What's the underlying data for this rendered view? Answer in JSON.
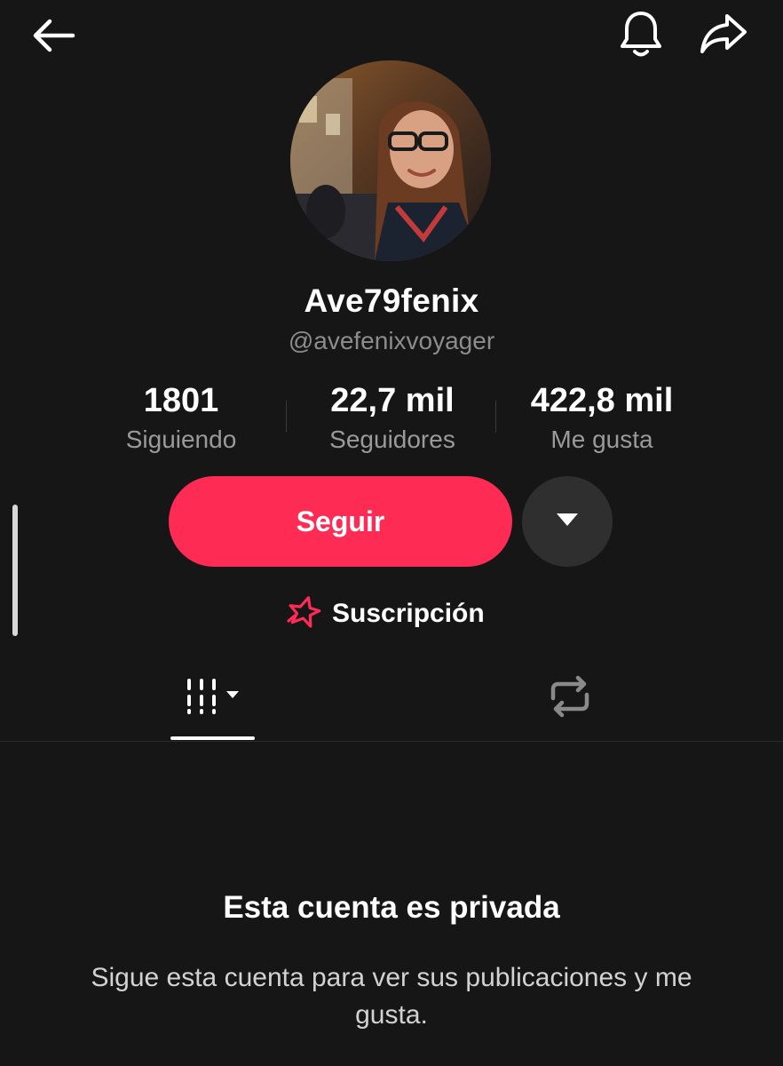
{
  "header": {
    "back_icon": "arrow-left-icon",
    "notify_icon": "bell-icon",
    "share_icon": "share-arrow-icon"
  },
  "profile": {
    "avatar": "profile-photo",
    "display_name": "Ave79fenix",
    "username": "@avefenixvoyager"
  },
  "stats": [
    {
      "value": "1801",
      "label": "Siguiendo"
    },
    {
      "value": "22,7 mil",
      "label": "Seguidores"
    },
    {
      "value": "422,8 mil",
      "label": "Me gusta"
    }
  ],
  "actions": {
    "follow_label": "Seguir",
    "more_icon": "caret-down-icon",
    "subscription_label": "Suscripción",
    "subscription_icon": "star-outline-icon"
  },
  "tabs": [
    {
      "icon": "video-grid-icon",
      "selected": true
    },
    {
      "icon": "repost-icon",
      "selected": false
    }
  ],
  "private_notice": {
    "title": "Esta cuenta es privada",
    "description": "Sigue esta cuenta para ver sus publicaciones y me gusta."
  },
  "colors": {
    "background": "#161616",
    "accent": "#fe2c55",
    "secondary_text": "#8c8c8c"
  }
}
